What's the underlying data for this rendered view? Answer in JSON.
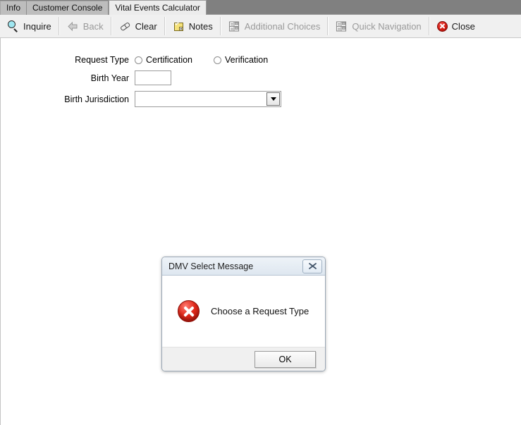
{
  "window": {
    "tabs": [
      {
        "label": "Info",
        "active": false
      },
      {
        "label": "Customer Console",
        "active": false
      },
      {
        "label": "Vital Events Calculator",
        "active": true
      }
    ]
  },
  "toolbar": {
    "buttons": [
      {
        "label": "Inquire",
        "icon": "magnifier-icon",
        "disabled": false
      },
      {
        "label": "Back",
        "icon": "left-arrow-icon",
        "disabled": true
      },
      {
        "label": "Clear",
        "icon": "eraser-icon",
        "disabled": false
      },
      {
        "label": "Notes",
        "icon": "notes-icon",
        "disabled": false
      },
      {
        "label": "Additional Choices",
        "icon": "grid-icon",
        "disabled": true
      },
      {
        "label": "Quick Navigation",
        "icon": "grid-icon",
        "disabled": true
      },
      {
        "label": "Close",
        "icon": "red-x-circle-icon",
        "disabled": false
      }
    ]
  },
  "form": {
    "request_type": {
      "label": "Request Type",
      "options": [
        {
          "label": "Certification",
          "selected": false
        },
        {
          "label": "Verification",
          "selected": false
        }
      ]
    },
    "birth_year": {
      "label": "Birth Year",
      "value": "",
      "placeholder": ""
    },
    "birth_jurisdiction": {
      "label": "Birth Jurisdiction",
      "value": "",
      "dropdown_icon": "chevron-down-icon"
    }
  },
  "dialog": {
    "title": "DMV Select Message",
    "close_icon": "close-icon",
    "error_icon": "error-x-circle-icon",
    "message": "Choose a Request Type",
    "ok_label": "OK"
  },
  "colors": {
    "error_red": "#d41b12",
    "tabstrip_gray": "#808080",
    "toolbar_bg": "#f0f0f0",
    "dialog_title_bg": "#e6eef6"
  }
}
